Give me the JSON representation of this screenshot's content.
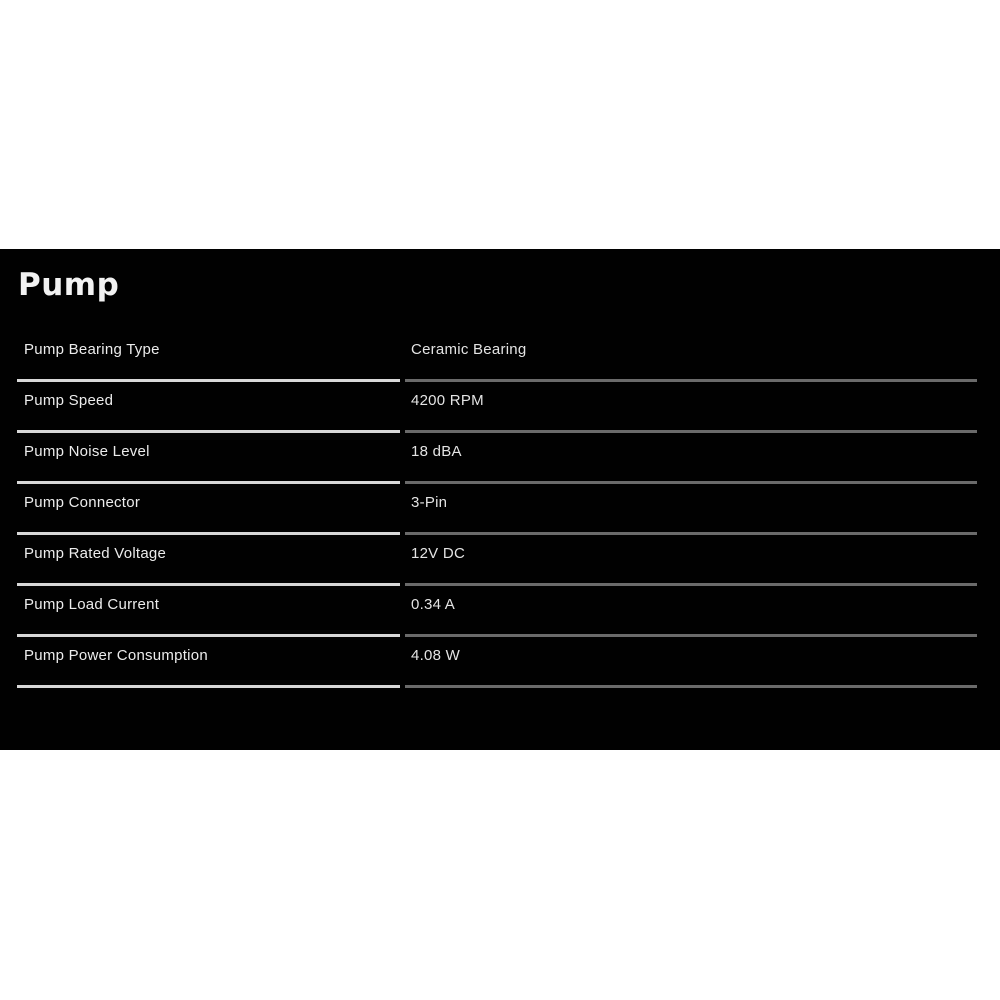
{
  "page": {
    "background_color": "#ffffff",
    "panel_background_color": "#010101",
    "label_rule_color": "#d8d8d8",
    "value_rule_color": "#6a6a6a",
    "text_color": "#ececec"
  },
  "section": {
    "title": "Pump"
  },
  "spec_table": {
    "rows": [
      {
        "label": "Pump Bearing Type",
        "value": "Ceramic Bearing"
      },
      {
        "label": "Pump Speed",
        "value": "4200 RPM"
      },
      {
        "label": "Pump Noise Level",
        "value": "18 dBA"
      },
      {
        "label": "Pump Connector",
        "value": "3-Pin"
      },
      {
        "label": "Pump Rated Voltage",
        "value": "12V DC"
      },
      {
        "label": "Pump Load Current",
        "value": "0.34 A"
      },
      {
        "label": "Pump Power Consumption",
        "value": "4.08 W"
      }
    ]
  }
}
